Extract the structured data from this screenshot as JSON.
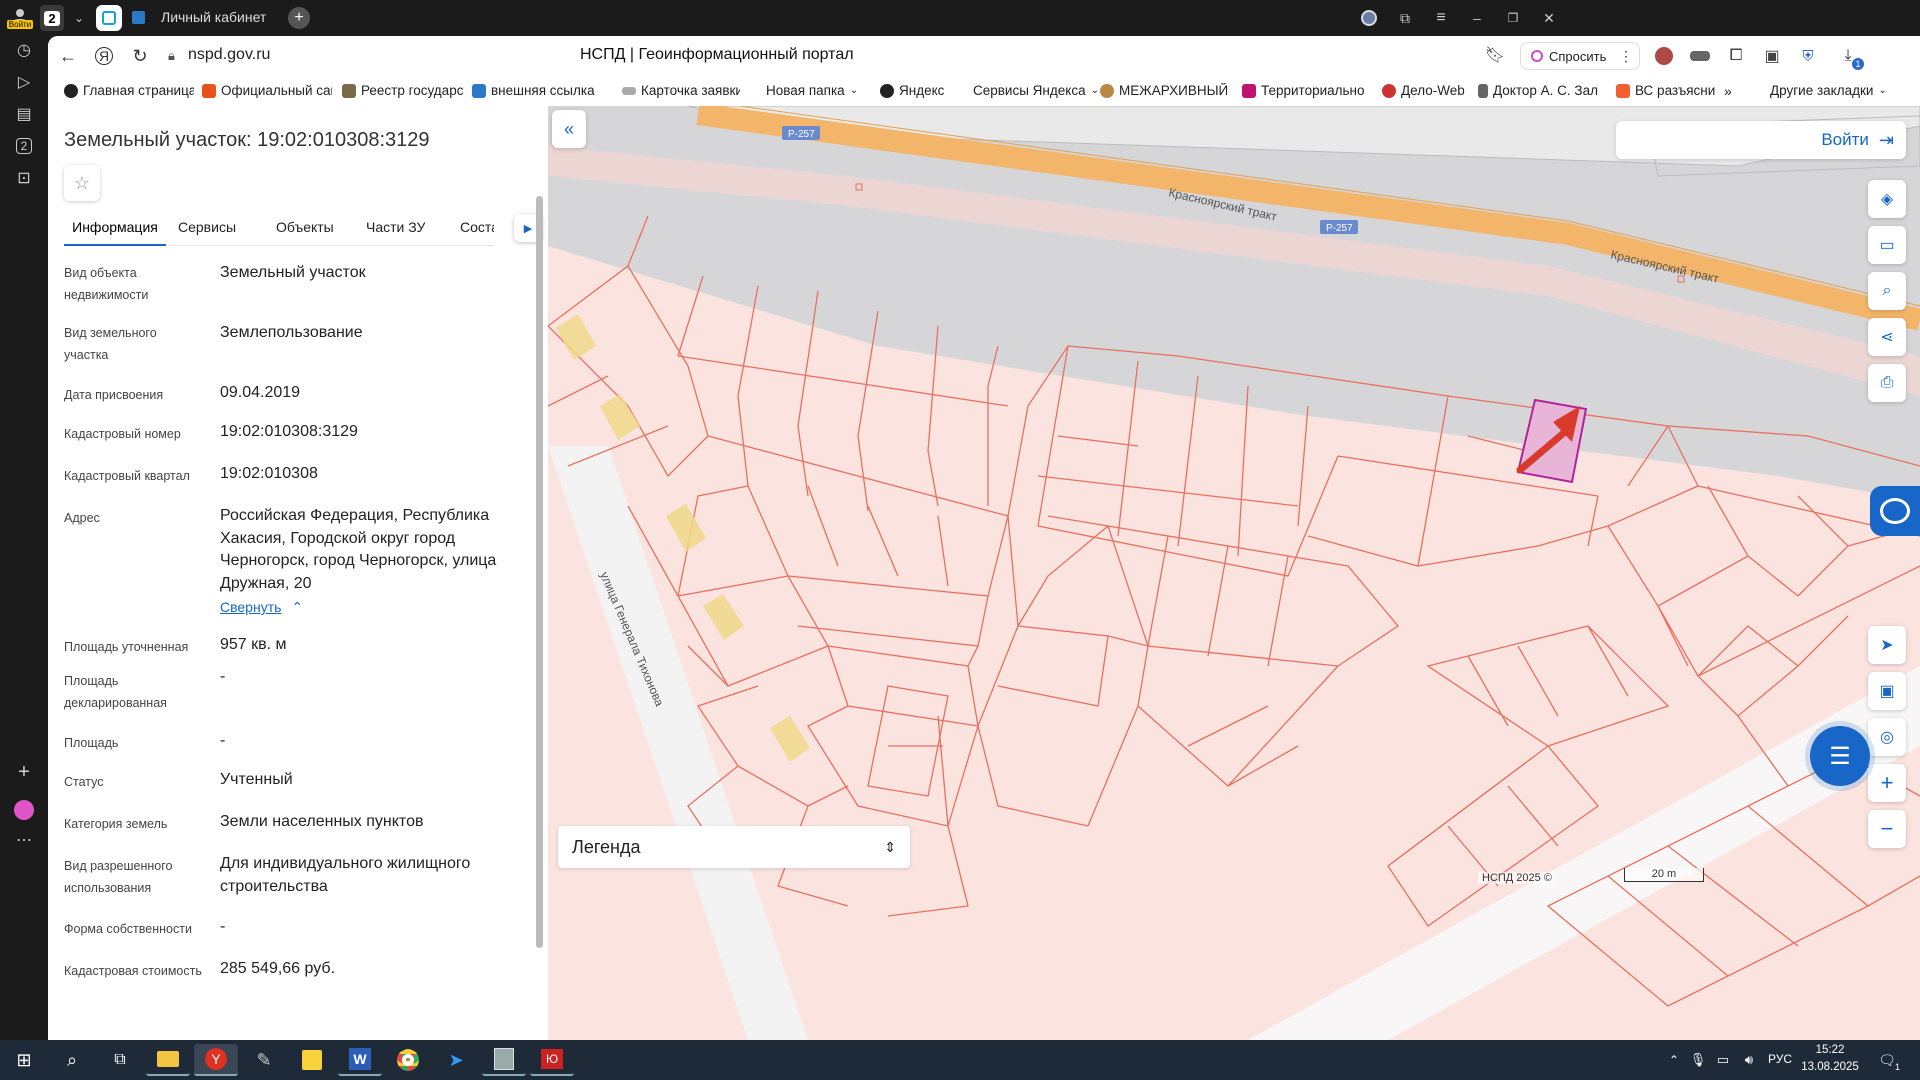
{
  "browser": {
    "profile_badge": "Войти",
    "tab_count": "2",
    "tab_title": "Личный кабинет",
    "url": "nspd.gov.ru",
    "page_title": "НСПД | Геоинформационный портал",
    "ask_label": "Спросить",
    "download_badge": "1"
  },
  "bookmarks": [
    {
      "label": "Главная страница",
      "color": "#222"
    },
    {
      "label": "Официальный сайт",
      "color": "#e8501c"
    },
    {
      "label": "Реестр государст",
      "color": "#7a6a4a"
    },
    {
      "label": "внешняя ссылка",
      "color": "#2a7ac8"
    },
    {
      "label": "Карточка заявки",
      "color": "#999"
    },
    {
      "label": "Новая папка",
      "color": ""
    },
    {
      "label": "Яндекс",
      "color": "#222"
    },
    {
      "label": "Сервисы Яндекса",
      "color": ""
    },
    {
      "label": "МЕЖАРХИВНЫЙ",
      "color": "#b84"
    },
    {
      "label": "Территориально",
      "color": "#c0146e"
    },
    {
      "label": "Дело-Web",
      "color": "#c33"
    },
    {
      "label": "Доктор А. С. Зал",
      "color": "#666"
    },
    {
      "label": "ВС разъясни",
      "color": "#f06030"
    },
    {
      "label": "Другие закладки",
      "color": ""
    }
  ],
  "panel": {
    "title": "Земельный участок: 19:02:010308:3129",
    "tabs": [
      "Информация",
      "Сервисы",
      "Объекты",
      "Части ЗУ",
      "Соста"
    ],
    "active_tab": 0,
    "collapse_link": "Свернуть",
    "fields": [
      {
        "label": "Вид объекта недвижимости",
        "value": "Земельный участок"
      },
      {
        "label": "Вид земельного участка",
        "value": "Землепользование"
      },
      {
        "label": "Дата присвоения",
        "value": "09.04.2019"
      },
      {
        "label": "Кадастровый номер",
        "value": "19:02:010308:3129"
      },
      {
        "label": "Кадастровый квартал",
        "value": "19:02:010308"
      },
      {
        "label": "Адрес",
        "value": "Российская Федерация, Республика Хакасия, Городской округ город Черногорск, город Черногорск, улица Дружная, 20"
      },
      {
        "label": "Площадь уточненная",
        "value": "957 кв. м"
      },
      {
        "label": "Площадь декларированная",
        "value": "-"
      },
      {
        "label": "Площадь",
        "value": "-"
      },
      {
        "label": "Статус",
        "value": "Учтенный"
      },
      {
        "label": "Категория земель",
        "value": "Земли населенных пунктов"
      },
      {
        "label": "Вид разрешенного использования",
        "value": "Для индивидуального жилищного строительства"
      },
      {
        "label": "Форма собственности",
        "value": "-"
      },
      {
        "label": "Кадастровая стоимость",
        "value": "285 549,66 руб."
      }
    ]
  },
  "map": {
    "login_label": "Войти",
    "road_label_1": "Красноярский тракт",
    "road_label_2": "Красноярский тракт",
    "road_code": "Р-257",
    "street_label": "улица Генерала Тихонова",
    "legend_label": "Легенда",
    "copyright": "НСПД 2025 ©",
    "scale_label": "20 m",
    "colors": {
      "parcel_line": "#e8705e",
      "parcel_fill": "#fbe3e0",
      "selected": "#b0249a",
      "road": "#f3b56a",
      "arrow": "#d83a2c"
    }
  },
  "taskbar": {
    "lang": "РУС",
    "time": "15:22",
    "date": "13.08.2025",
    "notif": "1"
  }
}
